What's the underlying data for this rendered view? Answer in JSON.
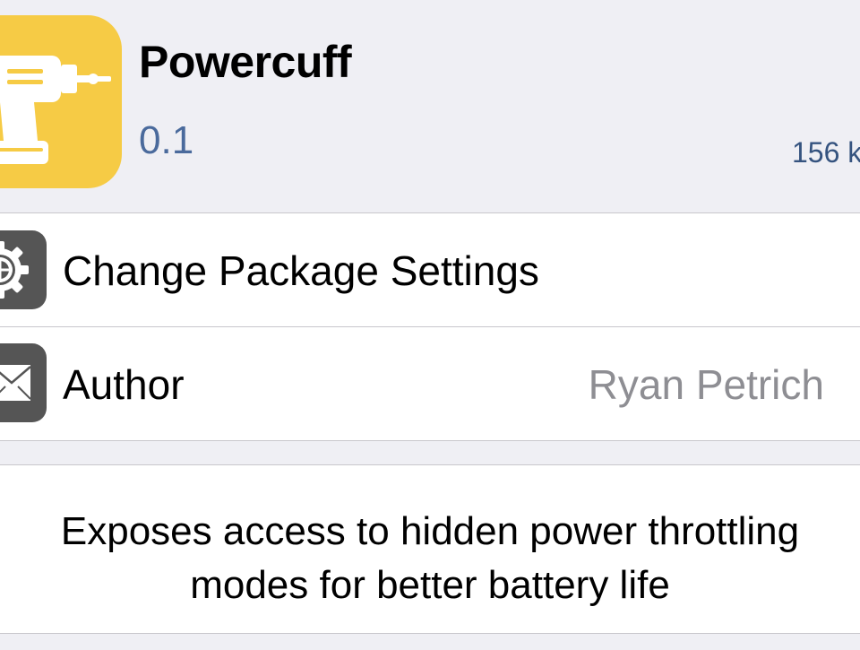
{
  "package": {
    "name": "Powercuff",
    "version": "0.1",
    "size": "156 k",
    "icon": "drill-icon",
    "icon_color": "#f6cb45"
  },
  "rows": [
    {
      "label": "Change Package Settings",
      "value": "",
      "icon": "gear-icon"
    },
    {
      "label": "Author",
      "value": "Ryan Petrich",
      "icon": "envelope-icon"
    }
  ],
  "description": "Exposes access to hidden power throttling modes for better battery life",
  "colors": {
    "background": "#efeff4",
    "cell_background": "#ffffff",
    "separator": "#c8c7cc",
    "version_text": "#4a6a9c",
    "secondary_text": "#8e8e93",
    "row_icon": "#555555"
  }
}
